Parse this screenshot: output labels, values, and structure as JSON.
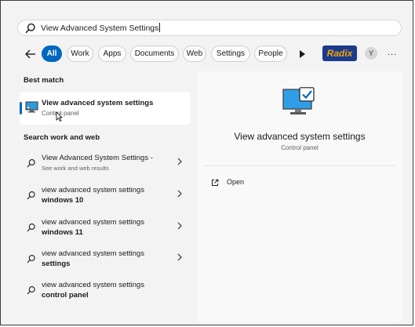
{
  "search": {
    "query": "View Advanced System Settings"
  },
  "filters": {
    "chips": [
      "All",
      "Work",
      "Apps",
      "Documents",
      "Web",
      "Settings",
      "People"
    ],
    "brand": "Radix",
    "avatar_initial": "Y",
    "more": "..."
  },
  "best_match": {
    "heading": "Best match",
    "title": "View advanced system settings",
    "subtitle": "Control panel"
  },
  "search_web": {
    "heading": "Search work and web",
    "items": [
      {
        "line1": "View Advanced System Settings -",
        "line2": "See work and web results",
        "sub": true
      },
      {
        "line1": "view advanced system settings",
        "line2": "windows 10",
        "sub": false
      },
      {
        "line1": "view advanced system settings",
        "line2": "windows 11",
        "sub": false
      },
      {
        "line1": "view advanced system settings",
        "line2": "settings",
        "sub": false
      },
      {
        "line1": "view advanced system settings",
        "line2": "control panel",
        "sub": false
      }
    ]
  },
  "detail": {
    "title": "View advanced system settings",
    "subtitle": "Control panel",
    "action_open": "Open"
  },
  "colors": {
    "accent": "#0067c0",
    "brand_bg": "#1a3a8f",
    "brand_fg": "#f5a400"
  }
}
